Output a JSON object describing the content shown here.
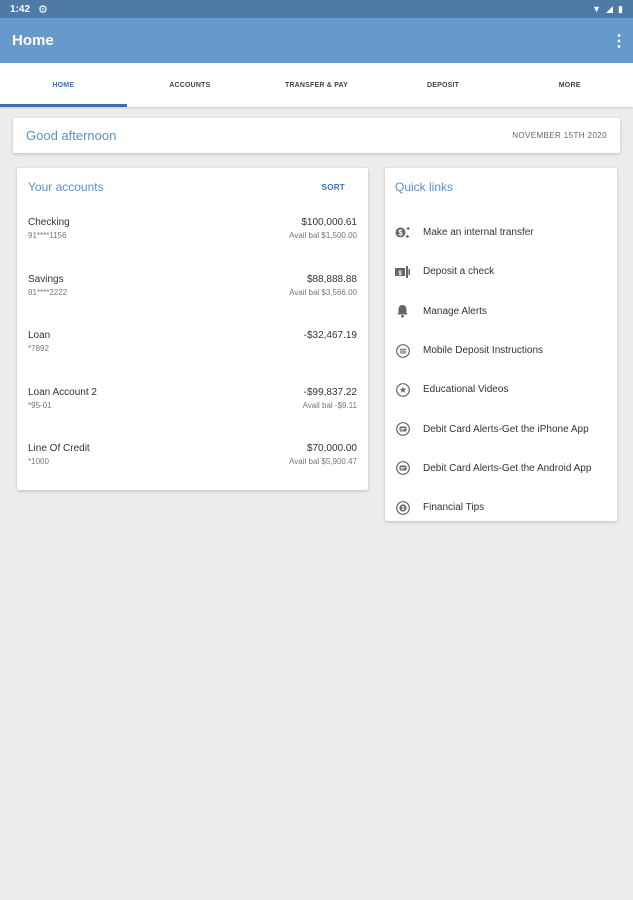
{
  "status_bar": {
    "time": "1:42"
  },
  "app_bar": {
    "title": "Home"
  },
  "tabs": [
    {
      "label": "HOME",
      "active": true
    },
    {
      "label": "ACCOUNTS",
      "active": false
    },
    {
      "label": "TRANSFER & PAY",
      "active": false
    },
    {
      "label": "DEPOSIT",
      "active": false
    },
    {
      "label": "MORE",
      "active": false
    }
  ],
  "greeting": {
    "text": "Good afternoon",
    "date": "NOVEMBER 15TH 2020"
  },
  "accounts": {
    "title": "Your accounts",
    "sort_label": "SORT",
    "items": [
      {
        "name": "Checking",
        "number": "91****1156",
        "balance": "$100,000.61",
        "available": "Avail bal $1,500.00"
      },
      {
        "name": "Savings",
        "number": "81****2222",
        "balance": "$88,888.88",
        "available": "Avail bal $3,566.00"
      },
      {
        "name": "Loan",
        "number": "*7892",
        "balance": "-$32,467.19",
        "available": ""
      },
      {
        "name": "Loan Account 2",
        "number": "*95-01",
        "balance": "-$99,837.22",
        "available": "Avail bal -$9.11"
      },
      {
        "name": "Line Of Credit",
        "number": "*1000",
        "balance": "$70,000.00",
        "available": "Avail bal $5,900.47"
      }
    ]
  },
  "quick_links": {
    "title": "Quick links",
    "items": [
      {
        "label": "Make an internal transfer",
        "icon": "transfer-icon"
      },
      {
        "label": "Deposit a check",
        "icon": "deposit-check-icon"
      },
      {
        "label": "Manage Alerts",
        "icon": "bell-icon"
      },
      {
        "label": "Mobile Deposit Instructions",
        "icon": "document-icon"
      },
      {
        "label": "Educational Videos",
        "icon": "star-icon"
      },
      {
        "label": "Debit Card Alerts-Get the iPhone App",
        "icon": "chat-icon"
      },
      {
        "label": "Debit Card Alerts-Get the Android App",
        "icon": "chat-icon"
      },
      {
        "label": "Financial Tips",
        "icon": "info-icon"
      }
    ]
  },
  "colors": {
    "app_bar": "#6699cc",
    "status_bar": "#4f7aa8",
    "accent": "#3b6fb6",
    "heading": "#5b8ed0"
  }
}
